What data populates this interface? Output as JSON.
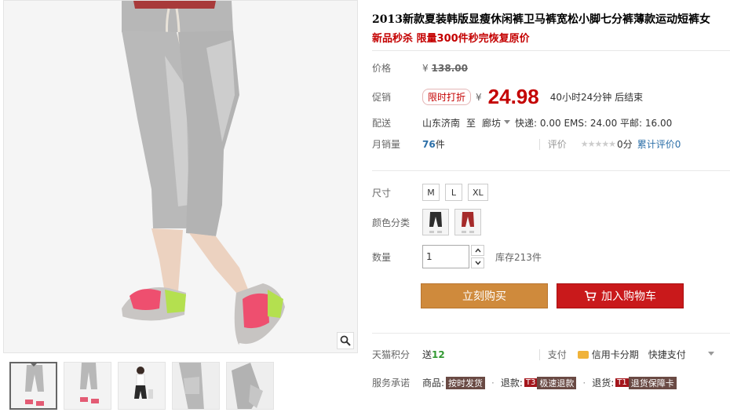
{
  "product": {
    "title": "2013新款夏装韩版显瘦休闲裤卫马裤宽松小脚七分裤薄款运动短裤女",
    "subtitle": "新品秒杀 限量300件秒完恢复原价"
  },
  "price": {
    "label": "价格",
    "currency": "¥",
    "original": "138.00"
  },
  "promo": {
    "label": "促销",
    "badge": "限时打折",
    "currency": "¥",
    "price": "24.98",
    "countdown": "40小时24分钟 后结束"
  },
  "delivery": {
    "label": "配送",
    "from": "山东济南",
    "to_word": "至",
    "to": "廊坊",
    "fees": "快递: 0.00 EMS: 24.00 平邮: 16.00"
  },
  "sales": {
    "label": "月销量",
    "count": "76",
    "unit": "件",
    "rating_label": "评价",
    "stars": "★★★★★",
    "score": "0分",
    "review_link": "累计评价0"
  },
  "options": {
    "size_label": "尺寸",
    "sizes": [
      "M",
      "L",
      "XL"
    ],
    "color_label": "颜色分类",
    "color_swatches": [
      "black-pants",
      "red-pants"
    ]
  },
  "quantity": {
    "label": "数量",
    "value": "1",
    "stock": "库存213件"
  },
  "actions": {
    "buy_now": "立刻购买",
    "add_to_cart": "加入购物车"
  },
  "tmall": {
    "points_label": "天猫积分",
    "points_prefix": "送",
    "points_value": "12",
    "pay_label": "支付",
    "credit": "信用卡分期",
    "quick_pay": "快捷支付"
  },
  "service": {
    "label": "服务承诺",
    "goods_label": "商品:",
    "goods_tag": "按时发货",
    "refund_label": "退款:",
    "refund_t": "T3",
    "refund_tag": "极速退款",
    "return_label": "退货:",
    "return_t": "T1",
    "return_tag": "退货保障卡"
  },
  "colors": {
    "accent_red": "#c40000",
    "buy_orange": "#cf8a3c",
    "cart_red": "#c9191b",
    "link_blue": "#2c6fa8",
    "points_green": "#339933"
  },
  "icons": [
    "zoom-icon",
    "cart-icon",
    "credit-card-icon",
    "chevron-down-icon"
  ]
}
